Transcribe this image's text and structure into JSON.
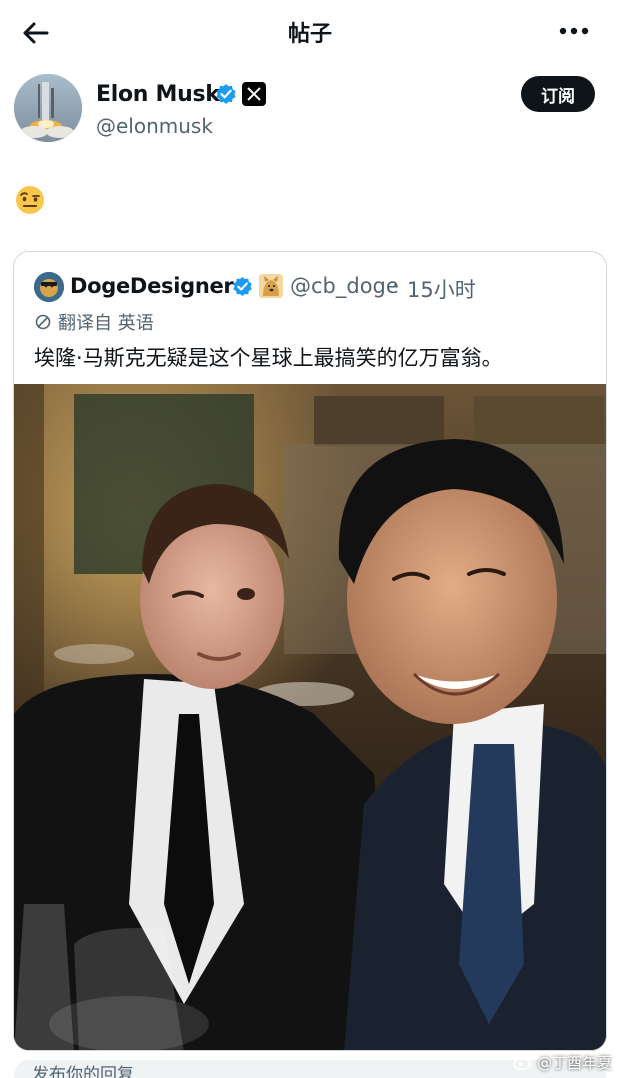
{
  "header": {
    "title": "帖子",
    "back_icon": "arrow-left-icon",
    "more_icon": "more-horizontal-icon"
  },
  "author": {
    "name": "Elon Musk",
    "handle": "@elonmusk",
    "verified": true,
    "affiliate_badge": "x-logo-icon",
    "subscribe_label": "订阅"
  },
  "post": {
    "emoji": "raised-eyebrow-emoji"
  },
  "quote": {
    "name": "DogeDesigner",
    "handle": "@cb_doge",
    "separator": "·",
    "time": "15小时",
    "translate_label": "翻译自 英语",
    "text": "埃隆·马斯克无疑是这个星球上最搞笑的亿万富翁。"
  },
  "reply": {
    "placeholder": "发布你的回复"
  },
  "watermark": {
    "text": "@丁酉年夏"
  },
  "colors": {
    "text": "#0f1419",
    "secondary": "#536471",
    "verified": "#1d9bf0",
    "border": "#cfd9de",
    "button_bg": "#0f1419"
  }
}
